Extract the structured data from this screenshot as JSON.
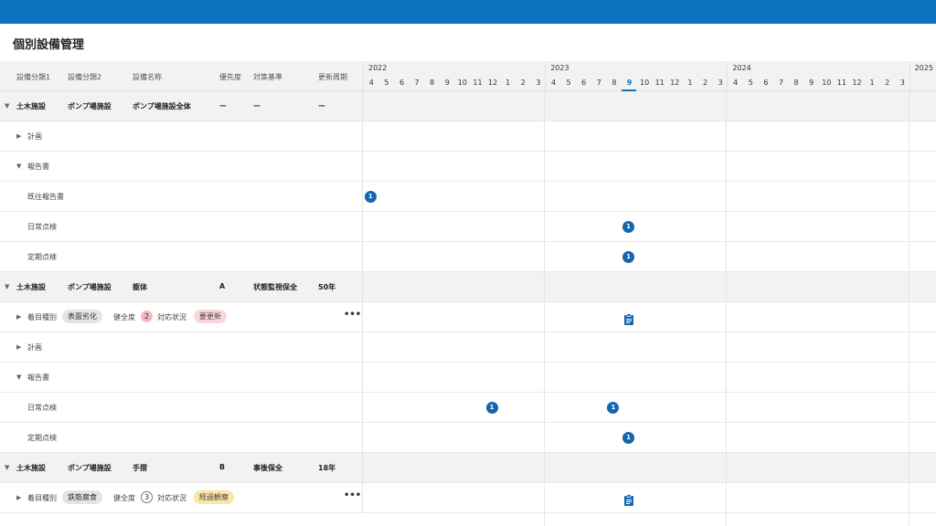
{
  "page_title": "個別設備管理",
  "columns": [
    "設備分類1",
    "設備分類2",
    "設備名称",
    "優先度",
    "対策基準",
    "更新周期"
  ],
  "timeline": {
    "years": [
      "2022",
      "2023",
      "2024",
      "2025"
    ],
    "months": [
      "4",
      "5",
      "6",
      "7",
      "8",
      "9",
      "10",
      "11",
      "12",
      "1",
      "2",
      "3"
    ],
    "current_month": "9"
  },
  "icons": {
    "expanded": "▼",
    "collapsed": "▶",
    "more": "•••"
  },
  "rows": [
    {
      "kind": "group",
      "cat1": "土木施設",
      "cat2": "ポンプ場施設",
      "name": "ポンプ場施設全体",
      "priority": "ー",
      "standard": "ー",
      "cycle": "ー"
    },
    {
      "kind": "section",
      "label": "計画",
      "expanded": false
    },
    {
      "kind": "section",
      "label": "報告書",
      "expanded": true
    },
    {
      "kind": "item",
      "label": "既往報告書"
    },
    {
      "kind": "item",
      "label": "日常点検"
    },
    {
      "kind": "item",
      "label": "定期点検"
    },
    {
      "kind": "group",
      "cat1": "土木施設",
      "cat2": "ポンプ場施設",
      "name": "躯体",
      "priority": "A",
      "standard": "状態監視保全",
      "cycle": "50年"
    },
    {
      "kind": "attr",
      "label": "着目種別",
      "tag": "表面劣化",
      "health_label": "健全度",
      "health": "2",
      "status_label": "対応状況",
      "status": "要更新"
    },
    {
      "kind": "section",
      "label": "計画",
      "expanded": false
    },
    {
      "kind": "section",
      "label": "報告書",
      "expanded": true
    },
    {
      "kind": "item",
      "label": "日常点検"
    },
    {
      "kind": "item",
      "label": "定期点検"
    },
    {
      "kind": "group",
      "cat1": "土木施設",
      "cat2": "ポンプ場施設",
      "name": "手摺",
      "priority": "B",
      "standard": "事後保全",
      "cycle": "18年"
    },
    {
      "kind": "attr",
      "label": "着目種別",
      "tag": "鉄筋腐食",
      "health_label": "健全度",
      "health": "3",
      "status_label": "対応状況",
      "status": "経過観察"
    }
  ],
  "markers": [
    {
      "row": 3,
      "year": "2022",
      "month": "4",
      "type": "count",
      "count": "1"
    },
    {
      "row": 4,
      "year": "2023",
      "month": "9",
      "type": "count",
      "count": "1"
    },
    {
      "row": 5,
      "year": "2023",
      "month": "9",
      "type": "count",
      "count": "1"
    },
    {
      "row": 7,
      "year": "2023",
      "month": "9",
      "type": "clipboard-icon"
    },
    {
      "row": 10,
      "year": "2022",
      "month": "12",
      "type": "count",
      "count": "1"
    },
    {
      "row": 10,
      "year": "2023",
      "month": "8",
      "type": "count",
      "count": "1"
    },
    {
      "row": 11,
      "year": "2023",
      "month": "9",
      "type": "count",
      "count": "1"
    },
    {
      "row": 13,
      "year": "2023",
      "month": "9",
      "type": "clipboard-icon"
    }
  ],
  "colors": {
    "accent": "#0d72c0",
    "marker": "#1565b0",
    "group_bg": "#f2f2f2"
  }
}
